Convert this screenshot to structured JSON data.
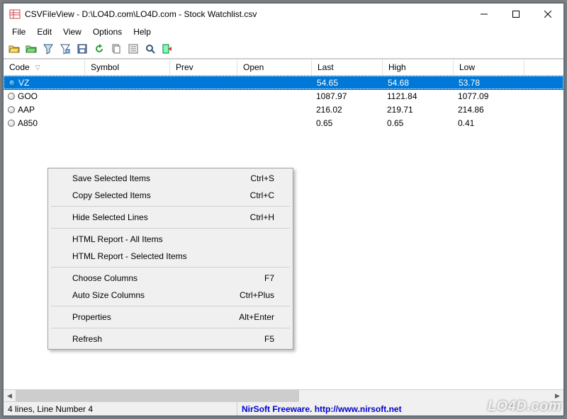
{
  "titlebar": {
    "title": "CSVFileView  -  D:\\LO4D.com\\LO4D.com - Stock Watchlist.csv"
  },
  "menubar": {
    "file": "File",
    "edit": "Edit",
    "view": "View",
    "options": "Options",
    "help": "Help"
  },
  "columns": {
    "code": "Code",
    "symbol": "Symbol",
    "prev": "Prev",
    "open": "Open",
    "last": "Last",
    "high": "High",
    "low": "Low"
  },
  "rows": [
    {
      "code": "VZ",
      "last": "54.65",
      "high": "54.68",
      "low": "53.78",
      "selected": true
    },
    {
      "code": "GOO",
      "last": "1087.97",
      "high": "1121.84",
      "low": "1077.09",
      "selected": false
    },
    {
      "code": "AAP",
      "last": "216.02",
      "high": "219.71",
      "low": "214.86",
      "selected": false
    },
    {
      "code": "A850",
      "last": "0.65",
      "high": "0.65",
      "low": "0.41",
      "selected": false
    }
  ],
  "context_menu": {
    "save_selected": {
      "label": "Save Selected Items",
      "shortcut": "Ctrl+S"
    },
    "copy_selected": {
      "label": "Copy Selected Items",
      "shortcut": "Ctrl+C"
    },
    "hide_selected": {
      "label": "Hide Selected Lines",
      "shortcut": "Ctrl+H"
    },
    "html_all": {
      "label": "HTML Report - All Items",
      "shortcut": ""
    },
    "html_selected": {
      "label": "HTML Report - Selected Items",
      "shortcut": ""
    },
    "choose_columns": {
      "label": "Choose Columns",
      "shortcut": "F7"
    },
    "autosize_columns": {
      "label": "Auto Size Columns",
      "shortcut": "Ctrl+Plus"
    },
    "properties": {
      "label": "Properties",
      "shortcut": "Alt+Enter"
    },
    "refresh": {
      "label": "Refresh",
      "shortcut": "F5"
    }
  },
  "statusbar": {
    "left": "4 lines, Line Number 4",
    "right": "NirSoft Freeware.  http://www.nirsoft.net"
  },
  "watermark": "LO4D.com"
}
